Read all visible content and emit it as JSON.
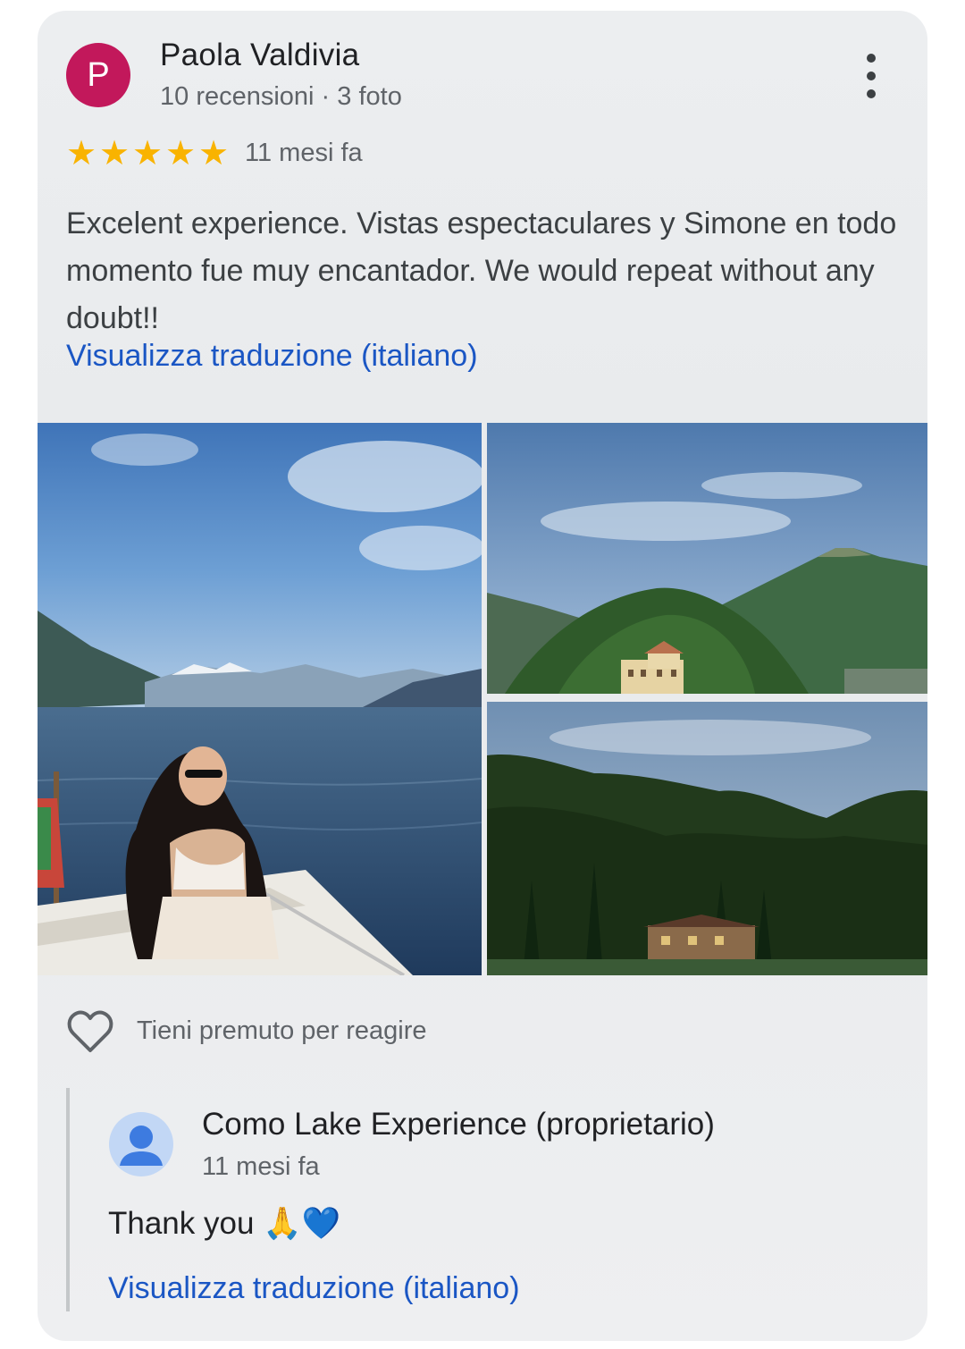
{
  "review": {
    "avatar_letter": "P",
    "avatar_color": "#c2185b",
    "author": "Paola Valdivia",
    "meta": "10 recensioni · 3 foto",
    "rating": 5,
    "star_color": "#f9b300",
    "time": "11 mesi fa",
    "text": "Excelent experience. Vistas espectaculares y Simone en todo momento fue muy encantador. We would repeat without any doubt!!",
    "translate_link": "Visualizza traduzione (italiano)"
  },
  "photos": [
    {
      "subject": "woman-on-boat-lake"
    },
    {
      "subject": "villa-on-hill"
    },
    {
      "subject": "forest-and-villa"
    }
  ],
  "reaction": {
    "icon": "heart-outline-icon",
    "label": "Tieni premuto per reagire"
  },
  "owner_reply": {
    "name": "Como Lake Experience (proprietario)",
    "time": "11 mesi fa",
    "text": "Thank you 🙏💙",
    "translate_link": "Visualizza traduzione (italiano)"
  }
}
